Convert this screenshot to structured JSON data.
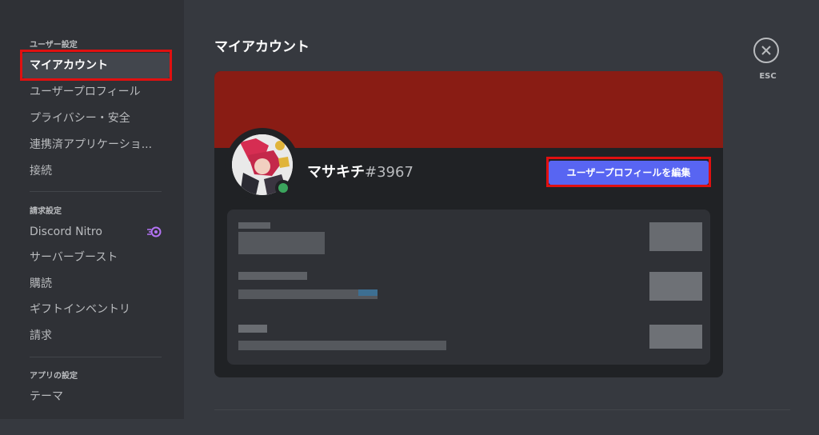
{
  "sidebar": {
    "user_settings_header": "ユーザー設定",
    "user_items": [
      {
        "label": "マイアカウント"
      },
      {
        "label": "ユーザープロフィール"
      },
      {
        "label": "プライバシー・安全"
      },
      {
        "label": "連携済アプリケーショ..."
      },
      {
        "label": "接続"
      }
    ],
    "billing_header": "請求設定",
    "billing_items": [
      {
        "label": "Discord Nitro",
        "icon": "nitro-icon"
      },
      {
        "label": "サーバーブースト"
      },
      {
        "label": "購読"
      },
      {
        "label": "ギフトインベントリ"
      },
      {
        "label": "請求"
      }
    ],
    "app_settings_header": "アプリの設定",
    "app_items": [
      {
        "label": "テーマ"
      }
    ]
  },
  "main": {
    "title": "マイアカウント",
    "username": "マサキチ",
    "discriminator": "#3967",
    "edit_profile_button": "ユーザープロフィールを編集"
  },
  "close": {
    "label": "ESC",
    "icon": "close-icon"
  },
  "colors": {
    "accent": "#5865f2",
    "banner": "#891c14",
    "highlight": "#e01010",
    "online": "#3ba55d"
  }
}
